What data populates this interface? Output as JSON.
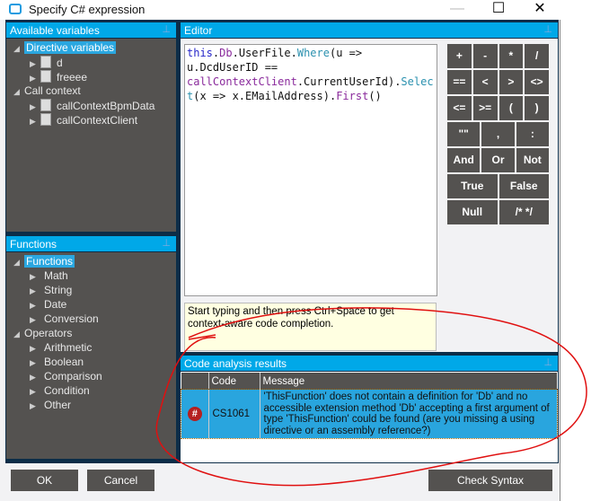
{
  "window": {
    "title": "Specify C# expression",
    "minimize": "—",
    "maximize": "☐",
    "close": "✕"
  },
  "variables": {
    "header": "Available variables",
    "groups": [
      {
        "label": "Directive variables",
        "items": [
          "d",
          "freeee"
        ]
      },
      {
        "label": "Call context",
        "items": [
          "callContextBpmData",
          "callContextClient"
        ]
      }
    ]
  },
  "functions": {
    "header": "Functions",
    "groups": [
      {
        "label": "Functions",
        "items": [
          "Math",
          "String",
          "Date",
          "Conversion"
        ]
      },
      {
        "label": "Operators",
        "items": [
          "Arithmetic",
          "Boolean",
          "Comparison",
          "Condition",
          "Other"
        ]
      }
    ]
  },
  "editor": {
    "header": "Editor",
    "code": [
      [
        [
          "kw",
          "this"
        ],
        [
          "",
          "."
        ],
        [
          "pr",
          "Db"
        ],
        [
          "",
          "."
        ],
        [
          "",
          "UserFile"
        ],
        [
          "",
          "."
        ],
        [
          "mt",
          "Where"
        ],
        [
          "",
          "(u =>"
        ]
      ],
      [
        [
          "",
          "u.DcdUserID =="
        ]
      ],
      [
        [
          "pr",
          "callContextClient"
        ],
        [
          "",
          ".CurrentUserId)."
        ],
        [
          "mt",
          "Selec"
        ]
      ],
      [
        [
          "mt",
          "t"
        ],
        [
          "",
          "(x => x.EMailAddress)."
        ],
        [
          "pr",
          "First"
        ],
        [
          "",
          "()"
        ]
      ]
    ],
    "hint": "Start typing and then press Ctrl+Space to get context-aware code completion."
  },
  "operators": [
    [
      "+",
      "-",
      "*",
      "/"
    ],
    [
      "==",
      "<",
      ">",
      "<>"
    ],
    [
      "<=",
      ">=",
      "(",
      ")"
    ],
    [
      "\"\"",
      ",",
      ":"
    ],
    [
      "And",
      "Or",
      "Not"
    ],
    [
      "True",
      "False"
    ],
    [
      "Null",
      "/* */"
    ]
  ],
  "analysis": {
    "header": "Code analysis results",
    "columns": [
      "",
      "Code",
      "Message"
    ],
    "rows": [
      {
        "icon": "#",
        "code": "CS1061",
        "message": "'ThisFunction' does not contain a definition for 'Db' and no accessible extension method 'Db' accepting a first argument of type 'ThisFunction' could be found (are you missing a using directive or an assembly reference?)"
      }
    ]
  },
  "buttons": {
    "ok": "OK",
    "cancel": "Cancel",
    "check": "Check Syntax"
  },
  "colors": {
    "accent": "#00a8e8",
    "panel": "#545250",
    "annotation": "#e01010"
  }
}
